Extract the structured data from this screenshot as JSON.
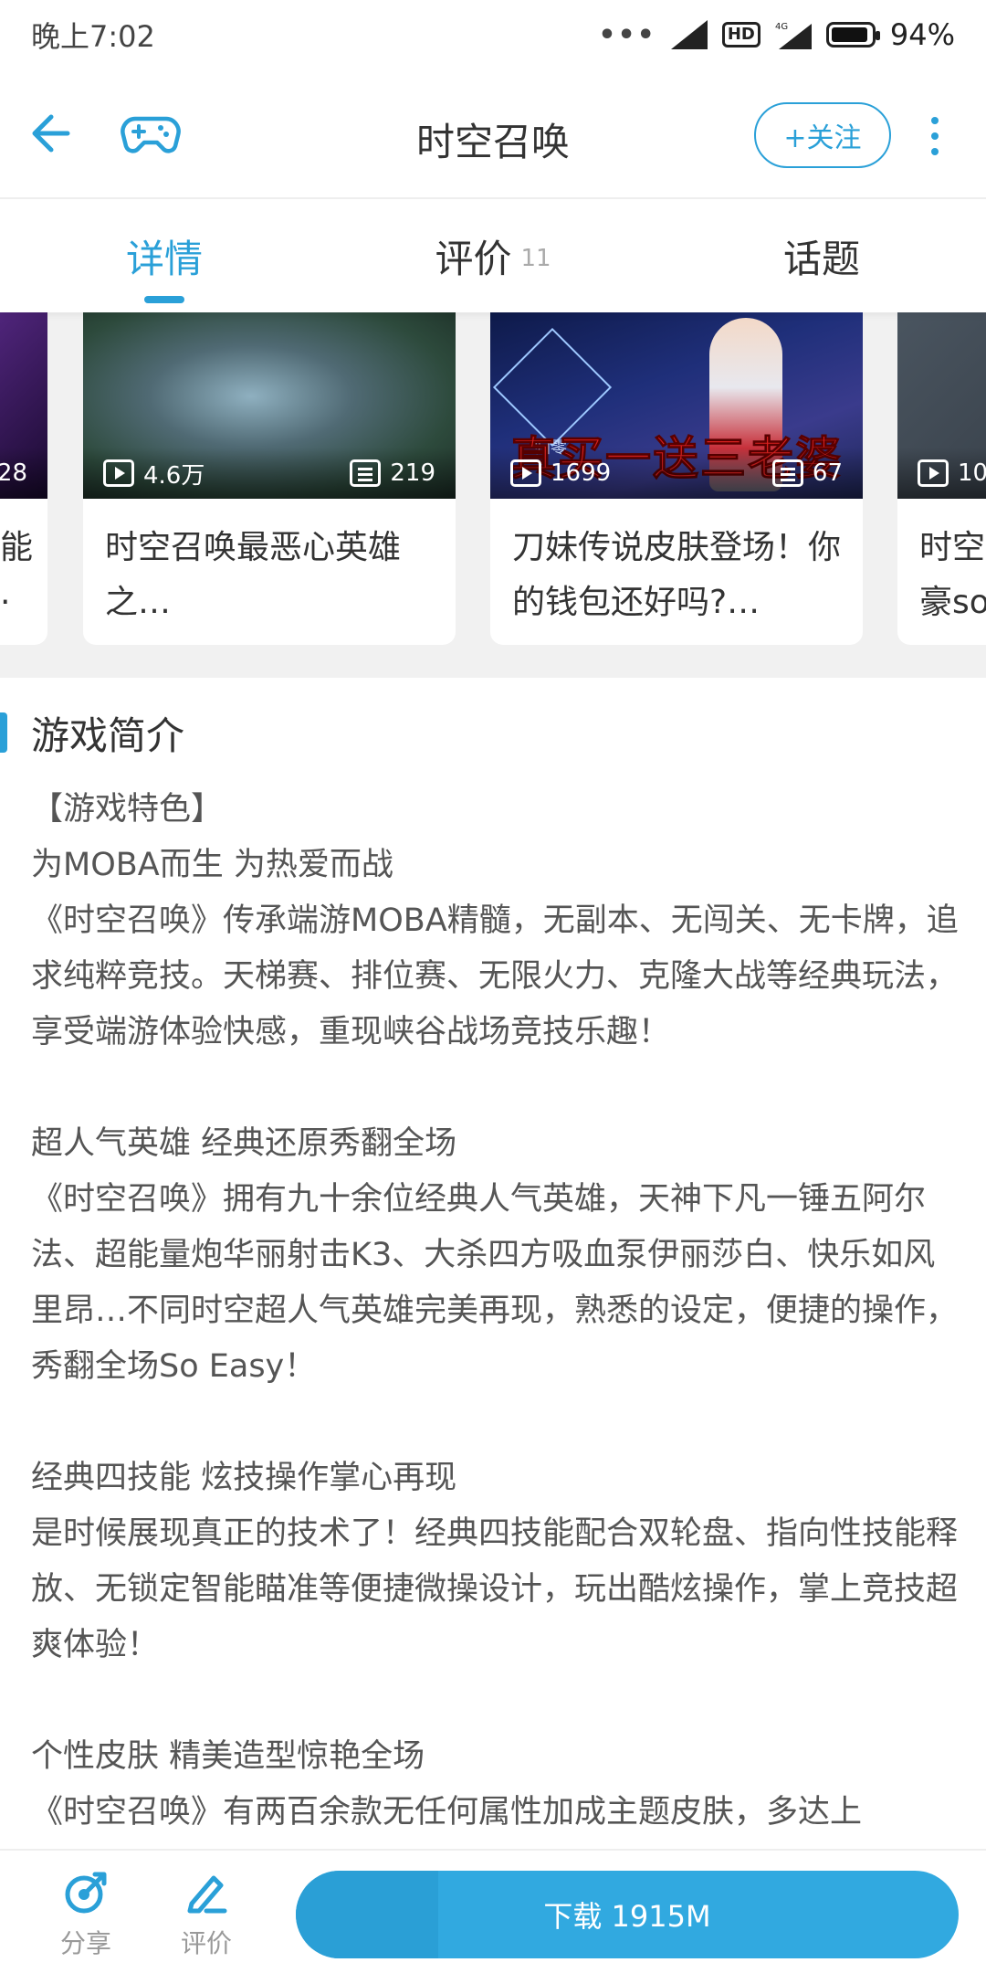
{
  "status_bar": {
    "time": "晚上7:02",
    "signal_dots": "•••",
    "hd": "HD",
    "net": "4G",
    "battery_pct": "94%",
    "battery_level": 0.94
  },
  "header": {
    "title": "时空召唤",
    "follow_label": "+关注"
  },
  "tabs": [
    {
      "label": "详情",
      "count": "",
      "active": true
    },
    {
      "label": "评价",
      "count": "11",
      "active": false
    },
    {
      "label": "话题",
      "count": "",
      "active": false
    }
  ],
  "videos": [
    {
      "plays": "",
      "comments": "28",
      "title": "能\n·"
    },
    {
      "plays": "4.6万",
      "comments": "219",
      "title": "时空召唤最恶心英雄之…"
    },
    {
      "plays": "1699",
      "comments": "67",
      "title": "刀妹传说皮肤登场！你的钱包还好吗?…",
      "overlay": "真买一送三老婆",
      "logo_text": "归零"
    },
    {
      "plays": "10",
      "comments": "",
      "title": "时空\n豪so"
    }
  ],
  "section": {
    "title": "游戏简介"
  },
  "description": "【游戏特色】\n为MOBA而生 为热爱而战\n《时空召唤》传承端游MOBA精髓，无副本、无闯关、无卡牌，追求纯粹竞技。天梯赛、排位赛、无限火力、克隆大战等经典玩法，享受端游体验快感，重现峡谷战场竞技乐趣！\n\n超人气英雄 经典还原秀翻全场\n《时空召唤》拥有九十余位经典人气英雄，天神下凡一锤五阿尔法、超能量炮华丽射击K3、大杀四方吸血泵伊丽莎白、快乐如风里昂…不同时空超人气英雄完美再现，熟悉的设定，便捷的操作，秀翻全场So Easy！\n\n经典四技能 炫技操作掌心再现\n是时候展现真正的技术了！经典四技能配合双轮盘、指向性技能释放、无锁定智能瞄准等便捷微操设计，玩出酷炫操作，掌上竞技超爽体验！\n\n个性皮肤 精美造型惊艳全场\n《时空召唤》有两百余款无任何属性加成主题皮肤，多达上",
  "bottom_bar": {
    "share_label": "分享",
    "review_label": "评价",
    "download_label": "下载 1915M"
  },
  "colors": {
    "accent": "#2aa0d8",
    "download": "#31a9e0"
  }
}
